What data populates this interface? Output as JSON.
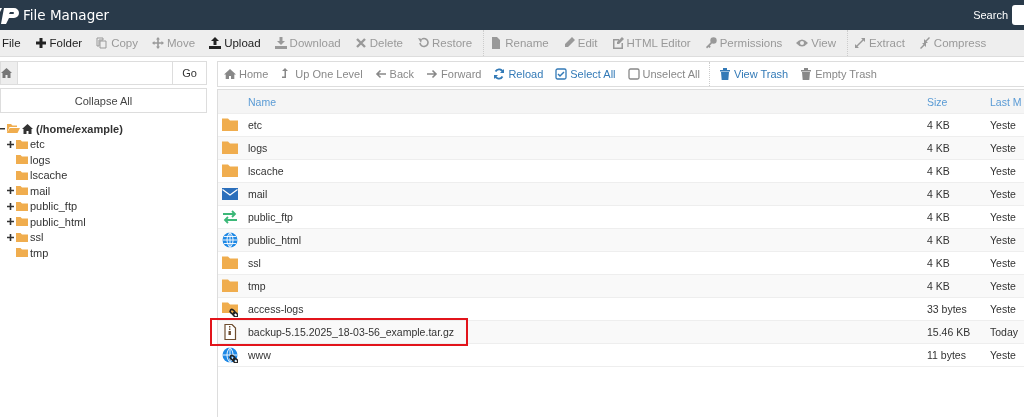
{
  "header": {
    "title": "File Manager",
    "search_label": "Search"
  },
  "toolbar": {
    "groups": [
      {
        "items": [
          {
            "label": "File",
            "disabled": false
          },
          {
            "label": "Folder",
            "disabled": false
          },
          {
            "label": "Copy",
            "disabled": true
          },
          {
            "label": "Move",
            "disabled": true
          },
          {
            "label": "Upload",
            "disabled": false
          },
          {
            "label": "Download",
            "disabled": true
          },
          {
            "label": "Delete",
            "disabled": true
          },
          {
            "label": "Restore",
            "disabled": true
          }
        ]
      },
      {
        "items": [
          {
            "label": "Rename",
            "disabled": true
          },
          {
            "label": "Edit",
            "disabled": true
          },
          {
            "label": "HTML Editor",
            "disabled": true
          },
          {
            "label": "Permissions",
            "disabled": true
          },
          {
            "label": "View",
            "disabled": true
          }
        ]
      },
      {
        "items": [
          {
            "label": "Extract",
            "disabled": true
          },
          {
            "label": "Compress",
            "disabled": true
          }
        ]
      }
    ]
  },
  "path_bar": {
    "go_label": "Go"
  },
  "collapse_label": "Collapse All",
  "tree": [
    {
      "label": "(/home/example)",
      "expanded": true,
      "children": [
        {
          "label": "etc",
          "expandable": true
        },
        {
          "label": "logs",
          "expandable": false
        },
        {
          "label": "lscache",
          "expandable": false
        },
        {
          "label": "mail",
          "expandable": true
        },
        {
          "label": "public_ftp",
          "expandable": true
        },
        {
          "label": "public_html",
          "expandable": true
        },
        {
          "label": "ssl",
          "expandable": true
        },
        {
          "label": "tmp",
          "expandable": false
        }
      ]
    }
  ],
  "nav": {
    "groups": [
      {
        "items": [
          {
            "label": "Home",
            "disabled": true
          },
          {
            "label": "Up One Level",
            "disabled": true
          },
          {
            "label": "Back",
            "disabled": true
          },
          {
            "label": "Forward",
            "disabled": true
          },
          {
            "label": "Reload",
            "disabled": false
          },
          {
            "label": "Select All",
            "disabled": false
          },
          {
            "label": "Unselect All",
            "disabled": true
          }
        ]
      },
      {
        "items": [
          {
            "label": "View Trash",
            "disabled": false
          },
          {
            "label": "Empty Trash",
            "disabled": true
          }
        ]
      }
    ]
  },
  "table": {
    "columns": [
      "Name",
      "Size",
      "Last M"
    ],
    "rows": [
      {
        "kind": "folder",
        "name": "etc",
        "size": "4 KB",
        "modified": "Yeste",
        "highlighted": false
      },
      {
        "kind": "folder",
        "name": "logs",
        "size": "4 KB",
        "modified": "Yeste",
        "highlighted": false
      },
      {
        "kind": "folder",
        "name": "lscache",
        "size": "4 KB",
        "modified": "Yeste",
        "highlighted": false
      },
      {
        "kind": "mail",
        "name": "mail",
        "size": "4 KB",
        "modified": "Yeste",
        "highlighted": false
      },
      {
        "kind": "ftp",
        "name": "public_ftp",
        "size": "4 KB",
        "modified": "Yeste",
        "highlighted": false
      },
      {
        "kind": "web",
        "name": "public_html",
        "size": "4 KB",
        "modified": "Yeste",
        "highlighted": false
      },
      {
        "kind": "folder",
        "name": "ssl",
        "size": "4 KB",
        "modified": "Yeste",
        "highlighted": false
      },
      {
        "kind": "folder",
        "name": "tmp",
        "size": "4 KB",
        "modified": "Yeste",
        "highlighted": false
      },
      {
        "kind": "folder-link",
        "name": "access-logs",
        "size": "33 bytes",
        "modified": "Yeste",
        "highlighted": false
      },
      {
        "kind": "archive",
        "name": "backup-5.15.2025_18-03-56_example.tar.gz",
        "size": "15.46 KB",
        "modified": "Today",
        "highlighted": true
      },
      {
        "kind": "web-link",
        "name": "www",
        "size": "11 bytes",
        "modified": "Yeste",
        "highlighted": false
      }
    ]
  }
}
